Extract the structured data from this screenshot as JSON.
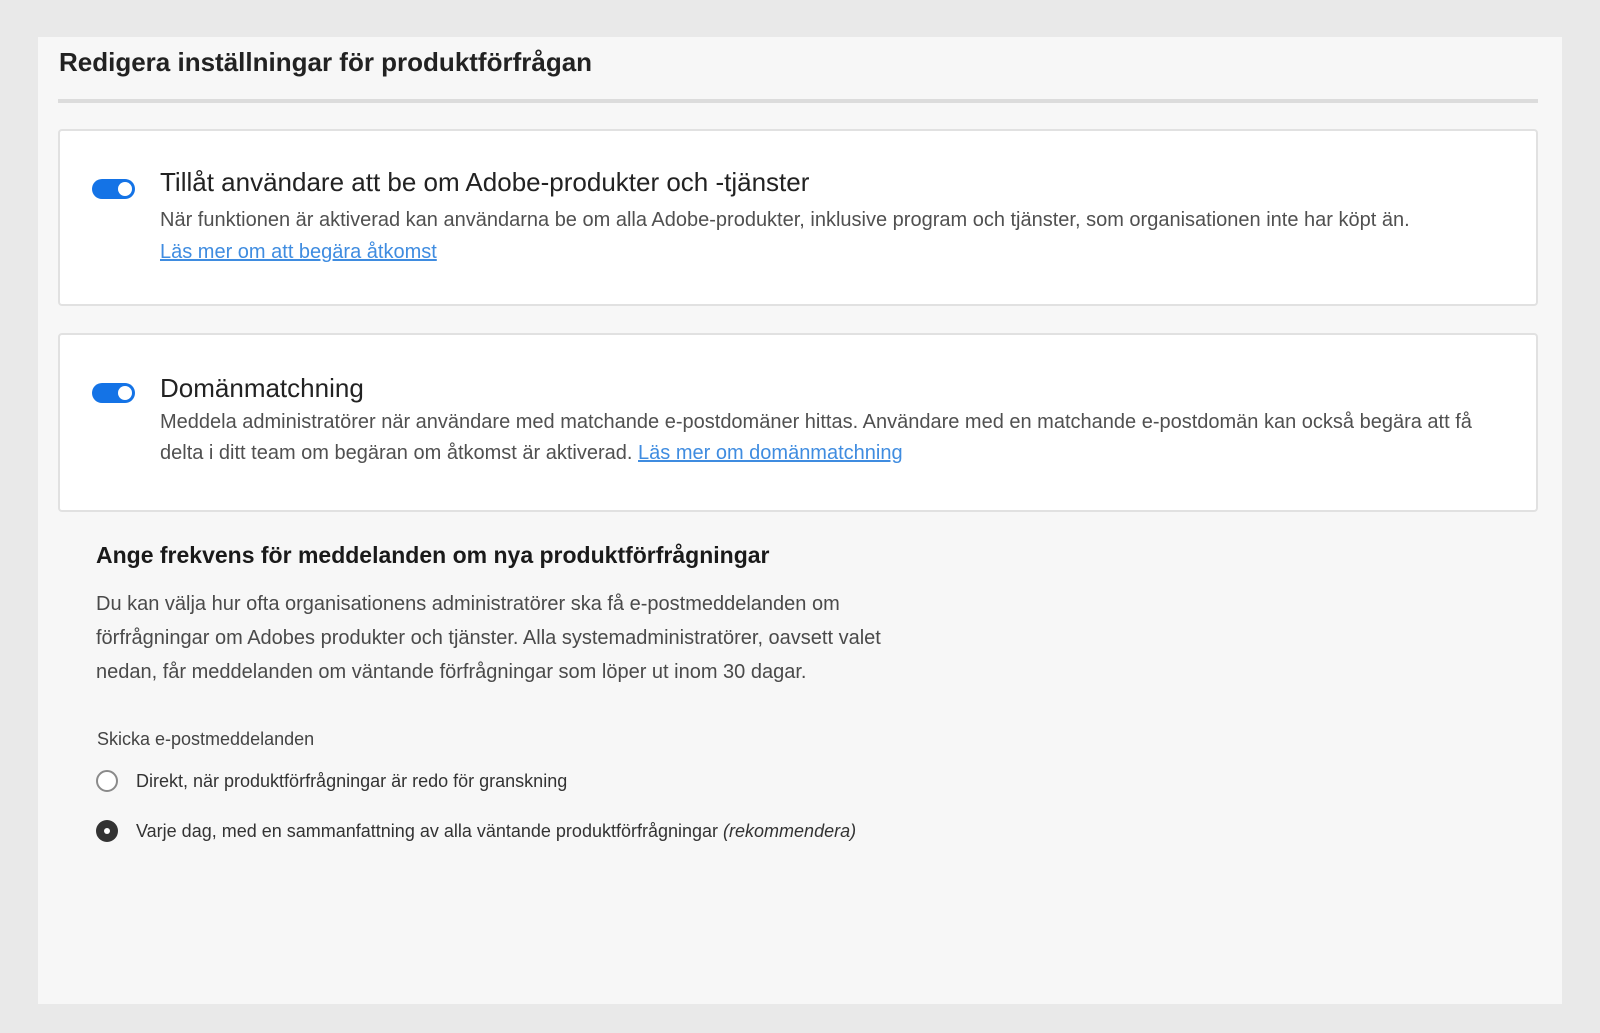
{
  "page": {
    "title": "Redigera inställningar för produktförfrågan"
  },
  "cards": [
    {
      "heading": "Tillåt användare att be om Adobe-produkter och -tjänster",
      "toggle_on": true,
      "description": "När funktionen är aktiverad kan användarna be om alla Adobe-produkter, inklusive program och tjänster, som organisationen inte har köpt än.",
      "link": "Läs mer om att begära åtkomst"
    },
    {
      "heading": "Domänmatchning",
      "toggle_on": true,
      "description": "Meddela administratörer när användare med matchande e-postdomäner hittas. Användare med en matchande e-postdomän kan också begära att få delta i ditt team om begäran om åtkomst är aktiverad.",
      "link": "Läs mer om domänmatchning"
    }
  ],
  "frequency": {
    "title": "Ange frekvens för meddelanden om nya produktförfrågningar",
    "description": "Du kan välja hur ofta organisationens administratörer ska få e-postmeddelanden om förfrågningar om Adobes produkter och tjänster. Alla systemadministratörer, oavsett valet nedan, får meddelanden om väntande förfrågningar som löper ut inom 30 dagar.",
    "email_label": "Skicka e-postmeddelanden",
    "options": [
      {
        "label": "Direkt, när produktförfrågningar är redo för granskning",
        "suffix": "",
        "selected": false
      },
      {
        "label": "Varje dag, med en sammanfattning av alla väntande produktförfrågningar",
        "suffix": "(rekommendera)",
        "selected": true
      }
    ]
  },
  "colors": {
    "accent": "#1473e6",
    "link": "#3f8ce0"
  }
}
